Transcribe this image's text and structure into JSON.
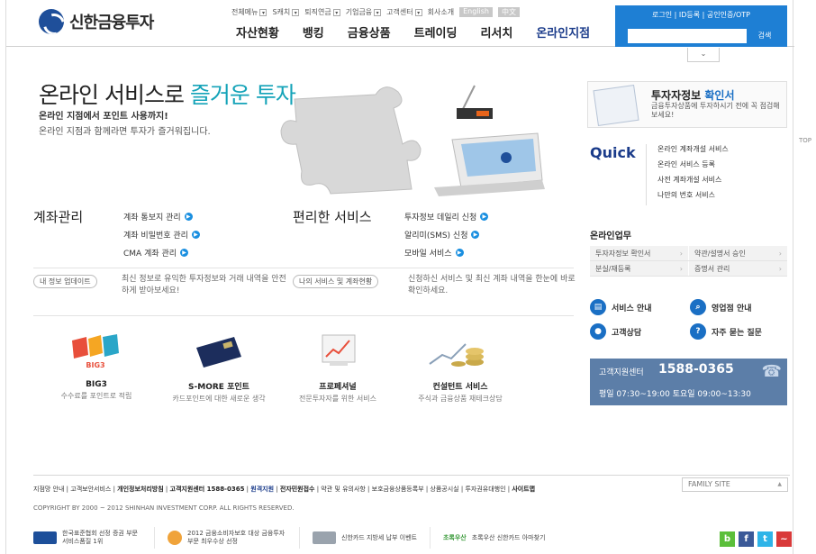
{
  "header": {
    "logo_text": "신한금융투자",
    "util_menu": [
      "전체메뉴",
      "S캐치",
      "퇴직연금",
      "기업금융",
      "고객센터",
      "회사소개"
    ],
    "lang_english": "English",
    "lang_chinese": "中文",
    "gnb": [
      "자산현황",
      "뱅킹",
      "금융상품",
      "트레이딩",
      "리서치",
      "온라인지점"
    ],
    "login_links": "로그인 | ID등록 | 공인인증/OTP",
    "search_button": "검색",
    "search_placeholder": "",
    "dropdown": "⌄",
    "top_link": "TOP"
  },
  "hero": {
    "title_a": "온라인 서비스로 ",
    "title_b": "즐거운 투자",
    "sub1": "온라인 지점에서 포인트 사용까지!",
    "sub2": "온라인 지점과 함께라면 투자가 즐거워집니다."
  },
  "account": {
    "title": "계좌관리",
    "links": [
      "계좌 통보지 관리",
      "계좌 비밀번호 관리",
      "CMA 계좌 관리"
    ]
  },
  "convenience": {
    "title": "편리한 서비스",
    "links": [
      "투자정보 데일리 신청",
      "알리미(SMS) 신청",
      "모바일 서비스"
    ]
  },
  "info_pills": {
    "left_pill": "내 정보 업데이트",
    "left_desc": "최신 정보로 유익한 투자정보와 거래 내역을 안전하게 받아보세요!",
    "right_pill": "나의 서비스 및 계좌현황",
    "right_desc": "신청하신 서비스 및 최신 계좌 내역을 한눈에 바로 확인하세요."
  },
  "products": [
    {
      "title": "BIG3",
      "desc": "수수료를 포인트로 적립"
    },
    {
      "title": "S-MORE 포인트",
      "desc": "카드포인트에 대한 새로운 생각"
    },
    {
      "title": "프로페셔널",
      "desc": "전문투자자를 위한 서비스"
    },
    {
      "title": "컨설턴트 서비스",
      "desc": "주식과 금융상품 재테크상담"
    }
  ],
  "big3_badge": "BIG3",
  "right": {
    "invest_title_a": "투자자정보 ",
    "invest_title_b": "확인서",
    "invest_desc": "금융투자상품에 투자하시기 전에 꼭 점검해보세요!",
    "quick_label": "Quick",
    "quick_links": [
      "온라인 계좌개설 서비스",
      "온라인 서비스 등록",
      "사전 계좌개설 서비스",
      "나만의 번호 서비스"
    ],
    "online_title": "온라인업무",
    "online_items": [
      "투자자정보 확인서",
      "약관/설명서 승인",
      "분실/재등록",
      "증명서 관리"
    ],
    "services": [
      "서비스 안내",
      "영업점 안내",
      "고객상담",
      "자주 묻는 질문"
    ],
    "cs_title": "고객지원센터",
    "cs_phone": "1588-0365",
    "cs_hours": "평일 07:30~19:00   토요일 09:00~13:30"
  },
  "footer": {
    "links": [
      "지점망 안내",
      "고객보안서비스",
      "개인정보처리방침",
      "고객지원센터 1588-0365",
      "원격지원",
      "전자민원접수",
      "약관 및 유의사항",
      "보호금융상품등록부",
      "상품공시실",
      "투자권유대행인",
      "사이트맵"
    ],
    "family_site": "FAMILY SITE",
    "copyright": "COPYRIGHT BY 2000 ~ 2012 SHINHAN INVESTMENT CORP. ALL RIGHTS RESERVED.",
    "banners": [
      "한국표준협회 선정 증권 부문 서비스품질 1위",
      "2012 금융소비자보호 대상 금융투자부문 최우수상 선정",
      "신한카드 지방세 납부 이벤트",
      "초록우산 신한카드 아마찾기"
    ],
    "banner_logo_text": "초록우산",
    "social": [
      "b",
      "f",
      "t",
      "~"
    ]
  },
  "colors": {
    "accent": "#1e7fd4",
    "brand": "#1a3b8a",
    "highlight": "#14a3b8"
  }
}
